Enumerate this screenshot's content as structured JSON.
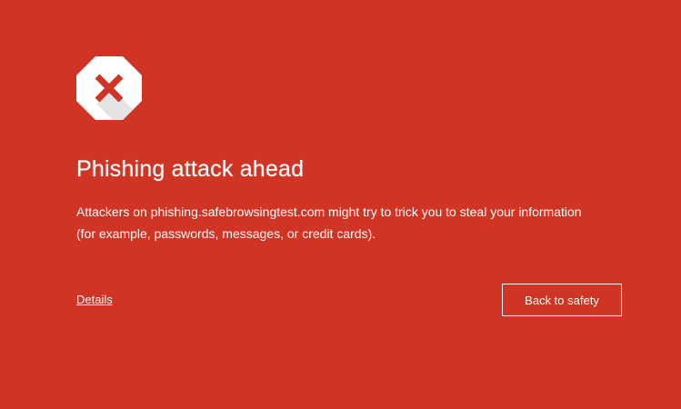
{
  "icons": {
    "warning": "error-octagon-icon"
  },
  "colors": {
    "background": "#cf3424",
    "icon_cross": "#cf3424"
  },
  "interstitial": {
    "heading": "Phishing attack ahead",
    "body": "Attackers on phishing.safebrowsingtest.com might try to trick you to steal your information (for example, passwords, messages, or credit cards).",
    "details_label": "Details",
    "back_button_label": "Back to safety"
  }
}
